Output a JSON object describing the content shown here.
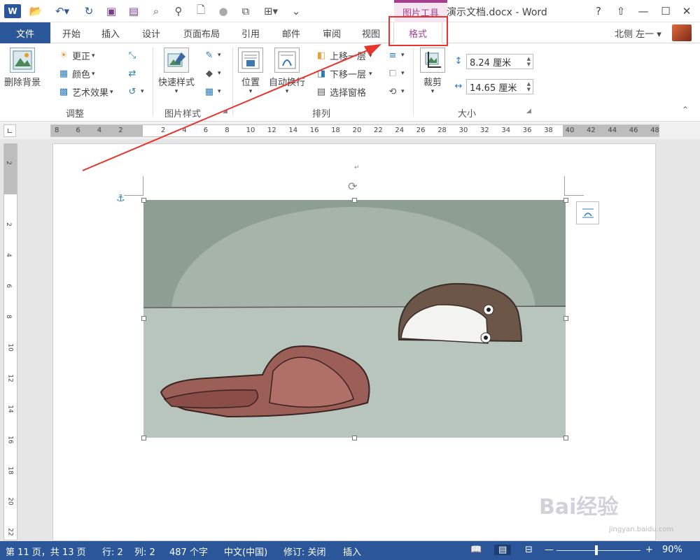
{
  "app": {
    "title": "演示文档.docx - Word",
    "tools_title": "图片工具"
  },
  "window": {
    "help": "?",
    "ribbon_display": "⇧",
    "minimize": "—",
    "maximize": "☐",
    "close": "✕"
  },
  "tabs": {
    "file": "文件",
    "home": "开始",
    "insert": "插入",
    "design": "设计",
    "layout": "页面布局",
    "references": "引用",
    "mailings": "邮件",
    "review": "审阅",
    "view": "视图",
    "format": "格式"
  },
  "user": {
    "name": "北侧 左一 ▾"
  },
  "ribbon": {
    "adjust": {
      "remove_bg": "删除背景",
      "corrections": "更正",
      "color": "颜色",
      "artistic": "艺术效果",
      "label": "调整"
    },
    "picture_styles": {
      "quick_styles": "快速样式",
      "label": "图片样式"
    },
    "arrange": {
      "position": "位置",
      "wrap_text": "自动换行",
      "bring_forward": "上移一层",
      "send_backward": "下移一层",
      "selection_pane": "选择窗格",
      "label": "排列"
    },
    "size": {
      "crop": "裁剪",
      "height": "8.24 厘米",
      "width": "14.65 厘米",
      "label": "大小"
    }
  },
  "ruler": {
    "ticks": [
      "8",
      "6",
      "4",
      "2",
      "",
      "2",
      "4",
      "6",
      "8",
      "10",
      "12",
      "14",
      "16",
      "18",
      "20",
      "22",
      "24",
      "26",
      "28",
      "30",
      "32",
      "34",
      "36",
      "38",
      "40",
      "42",
      "44",
      "46",
      "48"
    ],
    "vticks": [
      "2",
      "",
      "2",
      "4",
      "6",
      "8",
      "10",
      "12",
      "14",
      "16",
      "18",
      "20",
      "22"
    ]
  },
  "status": {
    "page": "第 11 页，共 13 页",
    "line": "行: 2",
    "column": "列: 2",
    "words": "487 个字",
    "language": "中文(中国)",
    "track_changes": "修订: 关闭",
    "mode": "插入",
    "zoom": "90%",
    "zoom_minus": "—",
    "zoom_plus": "+"
  },
  "watermark": {
    "text": "Bai经验",
    "sub": "jingyan.baidu.com"
  },
  "colors": {
    "word_blue": "#2b579a",
    "format_tab": "#a4408e",
    "annotation_red": "#e8342e"
  }
}
